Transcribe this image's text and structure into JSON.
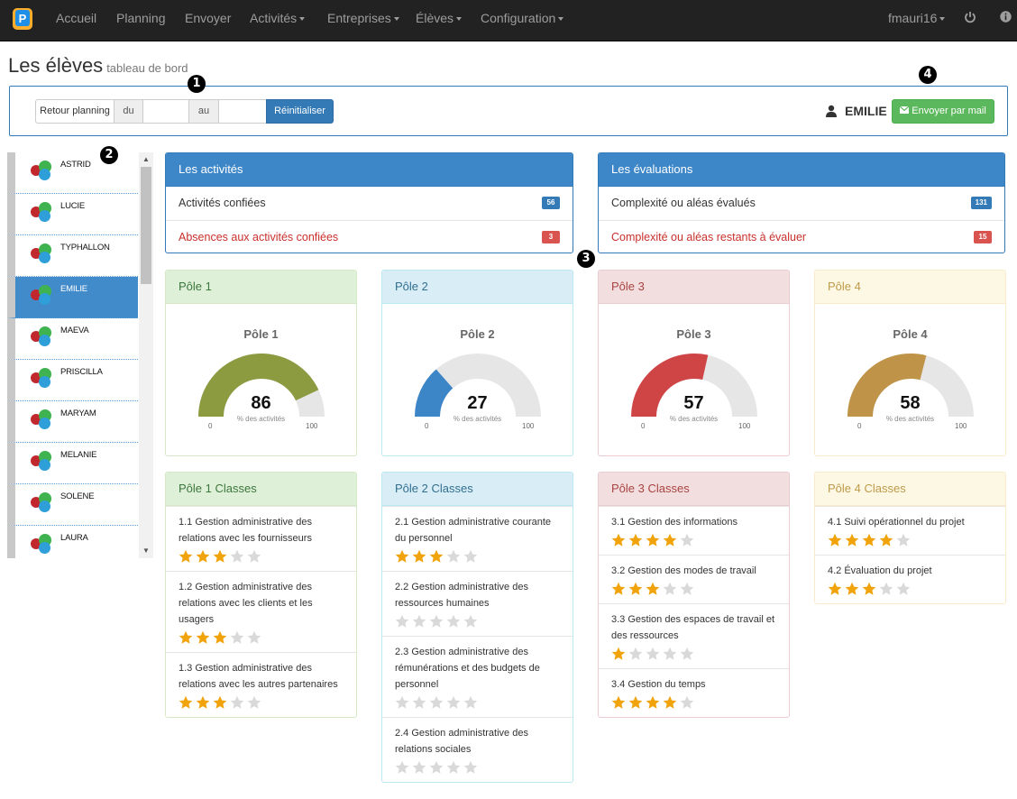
{
  "nav": {
    "logo_letter": "P",
    "items": [
      {
        "label": "Accueil",
        "dropdown": false
      },
      {
        "label": "Planning",
        "dropdown": false
      },
      {
        "label": "Envoyer",
        "dropdown": false
      },
      {
        "label": "Activités",
        "dropdown": true
      },
      {
        "label": "Entreprises",
        "dropdown": true
      },
      {
        "label": "Élèves",
        "dropdown": true
      },
      {
        "label": "Configuration",
        "dropdown": true
      }
    ],
    "user": "fmauri16",
    "icons": [
      "power-icon",
      "info-icon"
    ]
  },
  "page": {
    "title": "Les élèves",
    "subtitle": "tableau de bord"
  },
  "markers": [
    "1",
    "2",
    "3",
    "4"
  ],
  "toolbar": {
    "retour": "Retour planning",
    "du": "du",
    "au": "au",
    "reset": "Réinitialiser",
    "selected_student": "EMILIE",
    "send": "Envoyer par mail"
  },
  "students": [
    {
      "name": "ASTRID",
      "active": false
    },
    {
      "name": "LUCIE",
      "active": false
    },
    {
      "name": "TYPHALLON",
      "active": false
    },
    {
      "name": "EMILIE",
      "active": true
    },
    {
      "name": "MAEVA",
      "active": false
    },
    {
      "name": "PRISCILLA",
      "active": false
    },
    {
      "name": "MARYAM",
      "active": false
    },
    {
      "name": "MELANIE",
      "active": false
    },
    {
      "name": "SOLENE",
      "active": false
    },
    {
      "name": "LAURA",
      "active": false
    }
  ],
  "activities": {
    "title": "Les activités",
    "rows": [
      {
        "label": "Activités confiées",
        "count": "56",
        "kind": "blue"
      },
      {
        "label": "Absences aux activités confiées",
        "count": "3",
        "kind": "red"
      }
    ]
  },
  "evaluations": {
    "title": "Les évaluations",
    "rows": [
      {
        "label": "Complexité ou aléas évalués",
        "count": "131",
        "kind": "blue"
      },
      {
        "label": "Complexité ou aléas restants à évaluer",
        "count": "15",
        "kind": "red"
      }
    ]
  },
  "poles": [
    {
      "header": "Pôle 1",
      "title": "Pôle 1",
      "value": 86,
      "color": "#8c9a40",
      "style": "success",
      "unit": "% des activités",
      "min": "0",
      "max": "100"
    },
    {
      "header": "Pôle 2",
      "title": "Pôle 2",
      "value": 27,
      "color": "#3c86c8",
      "style": "info",
      "unit": "% des activités",
      "min": "0",
      "max": "100"
    },
    {
      "header": "Pôle 3",
      "title": "Pôle 3",
      "value": 57,
      "color": "#cf4546",
      "style": "danger",
      "unit": "% des activités",
      "min": "0",
      "max": "100"
    },
    {
      "header": "Pôle 4",
      "title": "Pôle 4",
      "value": 58,
      "color": "#c09448",
      "style": "warning",
      "unit": "% des activités",
      "min": "0",
      "max": "100"
    }
  ],
  "classes": [
    {
      "header": "Pôle 1 Classes",
      "style": "success",
      "items": [
        {
          "label": "1.1 Gestion administrative des relations avec les fournisseurs",
          "stars": 3
        },
        {
          "label": "1.2 Gestion administrative des relations avec les clients et les usagers",
          "stars": 3
        },
        {
          "label": "1.3 Gestion administrative des relations avec les autres partenaires",
          "stars": 3
        }
      ]
    },
    {
      "header": "Pôle 2 Classes",
      "style": "info",
      "items": [
        {
          "label": "2.1 Gestion administrative courante du personnel",
          "stars": 3
        },
        {
          "label": "2.2 Gestion administrative des ressources humaines",
          "stars": 0
        },
        {
          "label": "2.3 Gestion administrative des rémunérations et des budgets de personnel",
          "stars": 0
        },
        {
          "label": "2.4 Gestion administrative des relations sociales",
          "stars": 0
        }
      ]
    },
    {
      "header": "Pôle 3 Classes",
      "style": "danger",
      "items": [
        {
          "label": "3.1 Gestion des informations",
          "stars": 4
        },
        {
          "label": "3.2 Gestion des modes de travail",
          "stars": 3
        },
        {
          "label": "3.3 Gestion des espaces de travail et des ressources",
          "stars": 1
        },
        {
          "label": "3.4 Gestion du temps",
          "stars": 4
        }
      ]
    },
    {
      "header": "Pôle 4 Classes",
      "style": "warning",
      "items": [
        {
          "label": "4.1 Suivi opérationnel du projet",
          "stars": 4
        },
        {
          "label": "4.2 Évaluation du projet",
          "stars": 3
        }
      ]
    }
  ],
  "colors": {
    "star_on": "#f0a30a",
    "star_off": "#d9d9d9",
    "gauge_track": "#e6e6e6"
  }
}
